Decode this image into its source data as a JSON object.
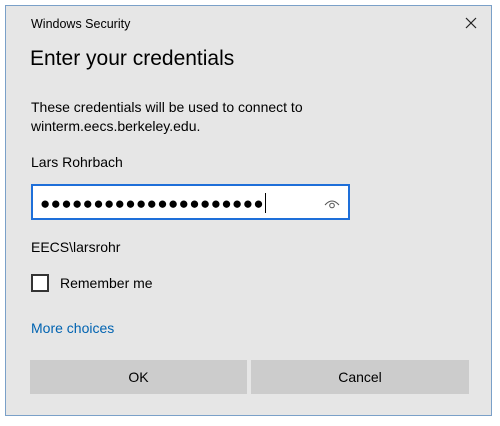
{
  "window": {
    "title": "Windows Security",
    "close_icon": "close-icon"
  },
  "dialog": {
    "heading": "Enter your credentials",
    "description": "These credentials will be used to connect to winterm.eecs.berkeley.edu.",
    "username": "Lars Rohrbach",
    "password_masked": "●●●●●●●●●●●●●●●●●●●●●",
    "reveal_icon": "eye-icon",
    "domain_user": "EECS\\larsrohr",
    "remember_label": "Remember me",
    "remember_checked": false,
    "more_choices": "More choices",
    "ok_label": "OK",
    "cancel_label": "Cancel"
  },
  "colors": {
    "dialog_bg": "#e6e6e6",
    "focus_border": "#1e6fd9",
    "link": "#0063b1",
    "button_bg": "#cccccc"
  }
}
